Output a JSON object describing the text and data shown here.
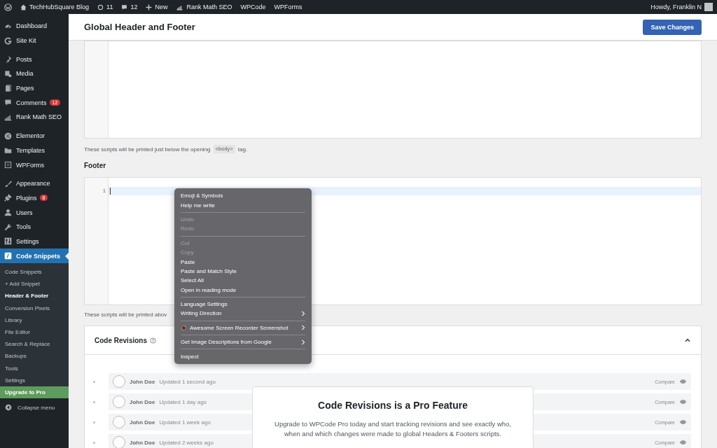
{
  "admin_bar": {
    "site": "TechHubSquare Blog",
    "updates": "11",
    "comments": "12",
    "new": "New",
    "links": [
      "Rank Math SEO",
      "WPCode",
      "WPForms"
    ],
    "greeting": "Howdy, Franklin N"
  },
  "sidebar": {
    "groups": [
      [
        {
          "label": "Dashboard",
          "selected": false
        },
        {
          "label": "Site Kit",
          "selected": false
        }
      ],
      [
        {
          "label": "Posts",
          "selected": false
        },
        {
          "label": "Media",
          "selected": false
        },
        {
          "label": "Pages",
          "selected": false
        },
        {
          "label": "Comments",
          "badge": "12",
          "selected": false
        },
        {
          "label": "Rank Math SEO",
          "selected": false
        }
      ],
      [
        {
          "label": "Elementor",
          "selected": false
        },
        {
          "label": "Templates",
          "selected": false
        },
        {
          "label": "WPForms",
          "selected": false
        }
      ],
      [
        {
          "label": "Appearance",
          "selected": false
        },
        {
          "label": "Plugins",
          "badge": "8",
          "selected": false
        },
        {
          "label": "Users",
          "selected": false
        },
        {
          "label": "Tools",
          "selected": false
        },
        {
          "label": "Settings",
          "selected": false
        },
        {
          "label": "Code Snippets",
          "selected": true
        }
      ]
    ],
    "submenu": [
      {
        "label": "Code Snippets",
        "selected": false,
        "kind": "link"
      },
      {
        "label": "+ Add Snippet",
        "selected": false,
        "kind": "link"
      },
      {
        "label": "Header & Footer",
        "selected": true,
        "kind": "link"
      },
      {
        "label": "Conversion Pixels",
        "selected": false,
        "kind": "link"
      },
      {
        "label": "Library",
        "selected": false,
        "kind": "link"
      },
      {
        "label": "File Editor",
        "selected": false,
        "kind": "link"
      },
      {
        "label": "Search & Replace",
        "selected": false,
        "kind": "link"
      },
      {
        "label": "Backups",
        "selected": false,
        "kind": "link"
      },
      {
        "label": "Tools",
        "selected": false,
        "kind": "link"
      },
      {
        "label": "Settings",
        "selected": false,
        "kind": "link"
      },
      {
        "label": "Upgrade to Pro",
        "selected": false,
        "kind": "upgrade"
      }
    ],
    "collapse": "Collapse menu"
  },
  "page": {
    "title": "Global Header and Footer",
    "save_button": "Save Changes"
  },
  "body_note": {
    "before": "These scripts will be printed just below the opening",
    "code": "<body>",
    "after": "tag."
  },
  "footer": {
    "heading": "Footer",
    "line_numbers": [
      "1"
    ],
    "note": "These scripts will be printed abov"
  },
  "revisions": {
    "title": "Code Revisions",
    "rows": [
      {
        "author": "John Doe",
        "updated": "Updated 1 second ago",
        "compare": "Compare"
      },
      {
        "author": "John Doe",
        "updated": "Updated 1 day ago",
        "compare": "Compare"
      },
      {
        "author": "John Doe",
        "updated": "Updated 1 week ago",
        "compare": "Compare"
      },
      {
        "author": "John Doe",
        "updated": "Updated 2 weeks ago",
        "compare": "Compare"
      }
    ],
    "pro": {
      "title": "Code Revisions is a Pro Feature",
      "text": "Upgrade to WPCode Pro today and start tracking revisions and see exactly who, when and which changes were made to global Headers & Footers scripts."
    }
  },
  "context_menu": [
    {
      "kind": "item",
      "label": "Emoji & Symbols",
      "disabled": false,
      "submenu": false
    },
    {
      "kind": "item",
      "label": "Help me write",
      "disabled": false,
      "submenu": false
    },
    {
      "kind": "separator"
    },
    {
      "kind": "item",
      "label": "Undo",
      "disabled": true,
      "submenu": false
    },
    {
      "kind": "item",
      "label": "Redo",
      "disabled": true,
      "submenu": false
    },
    {
      "kind": "separator"
    },
    {
      "kind": "item",
      "label": "Cut",
      "disabled": true,
      "submenu": false
    },
    {
      "kind": "item",
      "label": "Copy",
      "disabled": true,
      "submenu": false
    },
    {
      "kind": "item",
      "label": "Paste",
      "disabled": false,
      "submenu": false
    },
    {
      "kind": "item",
      "label": "Paste and Match Style",
      "disabled": false,
      "submenu": false
    },
    {
      "kind": "item",
      "label": "Select All",
      "disabled": false,
      "submenu": false
    },
    {
      "kind": "item",
      "label": "Open in reading mode",
      "disabled": false,
      "submenu": false
    },
    {
      "kind": "separator"
    },
    {
      "kind": "item",
      "label": "Language Settings",
      "disabled": false,
      "submenu": false
    },
    {
      "kind": "item",
      "label": "Writing Direction",
      "disabled": false,
      "submenu": true
    },
    {
      "kind": "separator"
    },
    {
      "kind": "extension",
      "label": "Awesome Screen Recorder  Screenshot",
      "disabled": false,
      "submenu": true
    },
    {
      "kind": "separator"
    },
    {
      "kind": "item",
      "label": "Get Image Descriptions from Google",
      "disabled": false,
      "submenu": true
    },
    {
      "kind": "separator"
    },
    {
      "kind": "item",
      "label": "Inspect",
      "disabled": false,
      "submenu": false
    }
  ]
}
